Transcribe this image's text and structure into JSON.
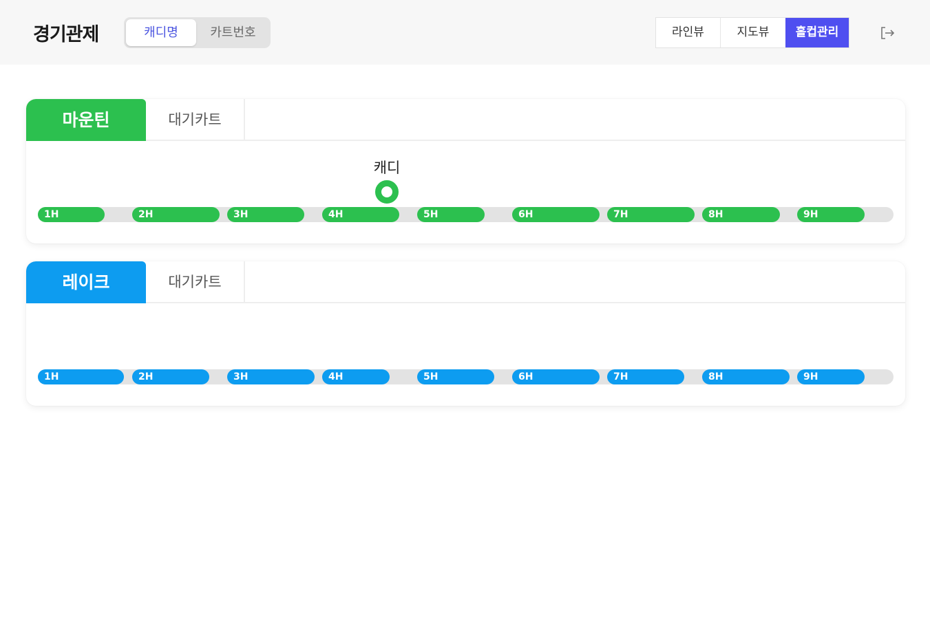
{
  "header": {
    "title": "경기관제",
    "toggle": {
      "options": [
        "캐디명",
        "카트번호"
      ],
      "selected": "캐디명"
    },
    "views": [
      {
        "label": "라인뷰"
      },
      {
        "label": "지도뷰"
      },
      {
        "label": "홀컵관리",
        "active": true
      }
    ],
    "logout_icon": "logout-icon"
  },
  "courses": [
    {
      "name": "마운틴",
      "color": "#2cc04f",
      "wait_tab": "대기카트",
      "holes": [
        "1H",
        "2H",
        "3H",
        "4H",
        "5H",
        "6H",
        "7H",
        "8H",
        "9H"
      ],
      "caddies": [
        {
          "name": "캐디",
          "position": "between 4H and 5H"
        }
      ]
    },
    {
      "name": "레이크",
      "color": "#0d9cf0",
      "wait_tab": "대기카트",
      "holes": [
        "1H",
        "2H",
        "3H",
        "4H",
        "5H",
        "6H",
        "7H",
        "8H",
        "9H"
      ],
      "caddies": []
    }
  ]
}
